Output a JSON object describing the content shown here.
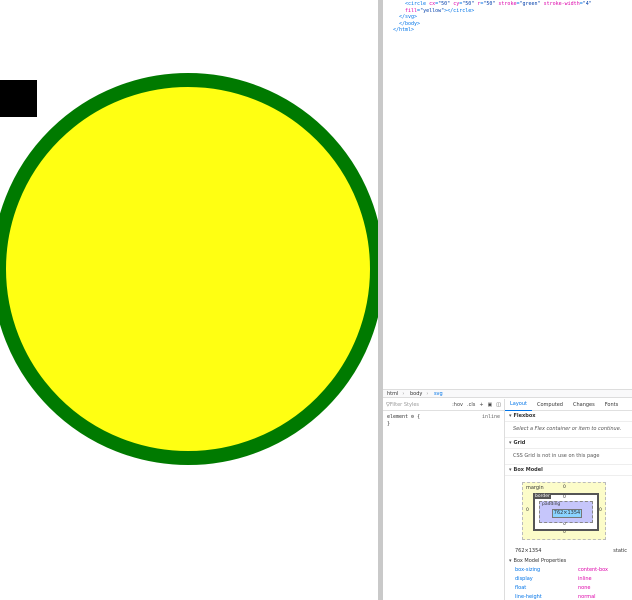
{
  "markup": {
    "lines": [
      {
        "indent": 2,
        "parts": [
          [
            "tag",
            "<circle "
          ],
          [
            "attr",
            "cx"
          ],
          [
            "tag",
            "="
          ],
          [
            "val",
            "\"50\" "
          ],
          [
            "attr",
            "cy"
          ],
          [
            "tag",
            "="
          ],
          [
            "val",
            "\"50\" "
          ],
          [
            "attr",
            "r"
          ],
          [
            "tag",
            "="
          ],
          [
            "val",
            "\"50\" "
          ],
          [
            "attr",
            "stroke"
          ],
          [
            "tag",
            "="
          ],
          [
            "val",
            "\"green\" "
          ],
          [
            "attr",
            "stroke-width"
          ],
          [
            "tag",
            "="
          ],
          [
            "val",
            "\"4\""
          ]
        ]
      },
      {
        "indent": 2,
        "parts": [
          [
            "attr",
            "fill"
          ],
          [
            "tag",
            "="
          ],
          [
            "val",
            "\"yellow\""
          ],
          [
            "tag",
            "></circle>"
          ]
        ]
      },
      {
        "indent": 1,
        "parts": [
          [
            "tag",
            "</svg>"
          ]
        ]
      },
      {
        "indent": 1,
        "parts": [
          [
            "tag",
            "</body>"
          ]
        ]
      },
      {
        "indent": 0,
        "parts": [
          [
            "tag",
            "</html>"
          ]
        ]
      }
    ]
  },
  "breadcrumb": [
    "html",
    "body",
    "svg"
  ],
  "rules": {
    "filter_placeholder": "Filter Styles",
    "hov": ":hov",
    "cls": ".cls",
    "add": "+",
    "element_rule": "element ",
    "element_open": "{",
    "element_close": "}",
    "inline": "inline"
  },
  "layout": {
    "tabs": [
      "Layout",
      "Computed",
      "Changes",
      "Fonts"
    ],
    "active_tab": "Layout",
    "flexbox_head": "Flexbox",
    "flexbox_msg": "Select a Flex container or item to continue.",
    "grid_head": "Grid",
    "grid_msg": "CSS Grid is not in use on this page",
    "boxmodel_head": "Box Model",
    "margin_label": "margin",
    "border_label": "border",
    "padding_label": "padding",
    "content_size": "762×1354",
    "zero": "0",
    "display_size": "762×1354",
    "position": "static",
    "props_head": "Box Model Properties",
    "props": [
      {
        "name": "box-sizing",
        "value": "content-box"
      },
      {
        "name": "display",
        "value": "inline"
      },
      {
        "name": "float",
        "value": "none"
      },
      {
        "name": "line-height",
        "value": "normal"
      }
    ]
  },
  "colors": {
    "circle_fill": "#ffff12",
    "circle_stroke": "#007a00",
    "square": "#000000"
  }
}
